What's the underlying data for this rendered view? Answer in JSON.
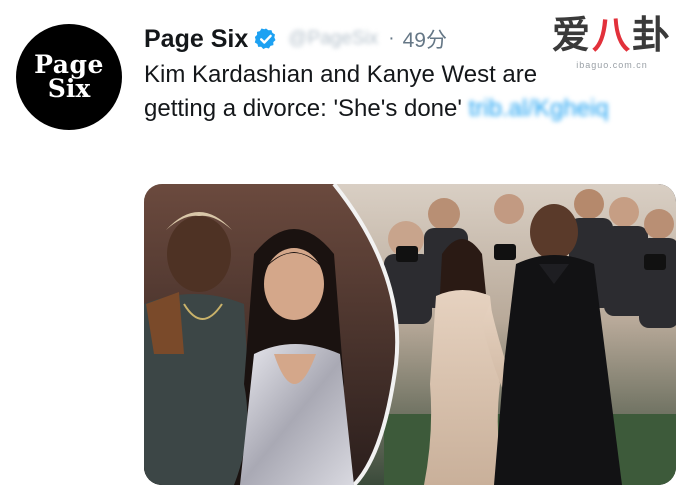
{
  "account": {
    "avatar_line1": "Page",
    "avatar_line2": "Six",
    "name": "Page Six",
    "handle": "@PageSix",
    "separator": "·",
    "time": "49分"
  },
  "tweet": {
    "text": "Kim Kardashian and Kanye West are getting a divorce: 'She's done'",
    "link": "trib.al/Kgheiq"
  },
  "watermark": {
    "main_left": "爱",
    "main_mid": "八",
    "main_right": "卦",
    "sub": "ibaguo.com.cn"
  },
  "media": {
    "description": "photo-collage"
  },
  "colors": {
    "verified": "#1da1f2",
    "link": "#1da1f2",
    "muted": "#657786"
  }
}
